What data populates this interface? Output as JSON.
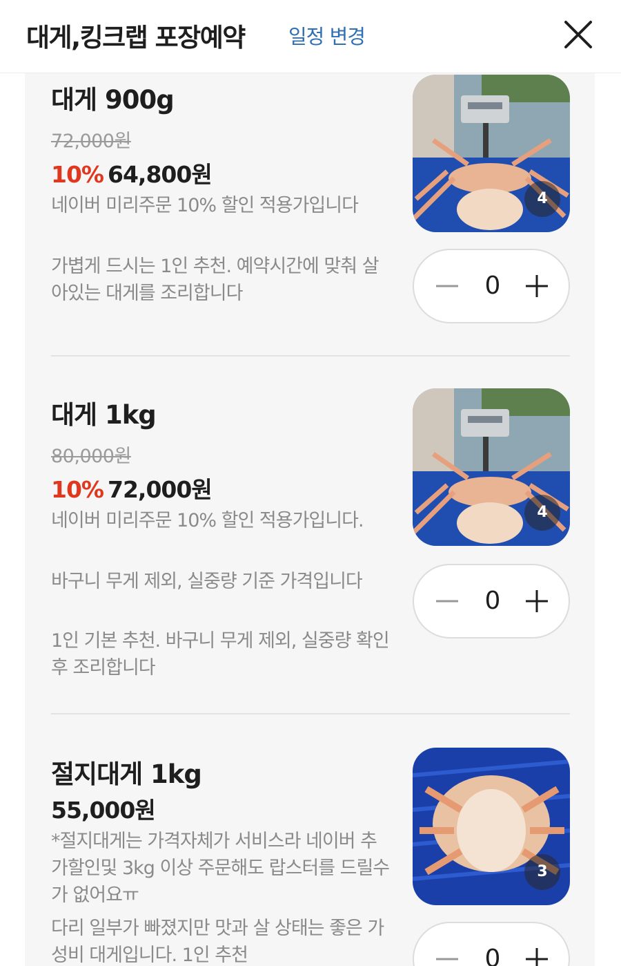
{
  "header": {
    "title": "대게,킹크랩 포장예약",
    "change_label": "일정 변경"
  },
  "products": [
    {
      "name": "대게 900g",
      "original_price": "72,000원",
      "discount_rate": "10%",
      "price": "64,800원",
      "descriptions": [
        "네이버 미리주문 10% 할인 적용가입니다",
        "가볍게 드시는 1인 추천. 예약시간에 맞춰 살아있는 대게를 조리합니다"
      ],
      "image_count": "4",
      "quantity": "0"
    },
    {
      "name": "대게 1kg",
      "original_price": "80,000원",
      "discount_rate": "10%",
      "price": "72,000원",
      "descriptions": [
        "네이버 미리주문 10% 할인 적용가입니다.",
        "바구니 무게 제외, 실중량 기준 가격입니다",
        "1인 기본 추천. 바구니 무게 제외, 실중량 확인 후 조리합니다"
      ],
      "image_count": "4",
      "quantity": "0"
    },
    {
      "name": "절지대게 1kg",
      "price": "55,000원",
      "descriptions": [
        "*절지대게는 가격자체가 서비스라 네이버 추가할인및 3kg 이상 주문해도 랍스터를 드릴수가 없어요ㅠ",
        "다리 일부가 빠졌지만 맛과 살 상태는 좋은 가성비 대게입니다. 1인 추천"
      ],
      "image_count": "3",
      "quantity": "0"
    }
  ],
  "colors": {
    "accent_link": "#2f6fb3",
    "discount": "#e0381f",
    "muted_text": "#8a8a8a",
    "background": "#f6f6f6"
  },
  "icons": {
    "close": "close-icon",
    "minus": "minus-icon",
    "plus": "plus-icon"
  }
}
